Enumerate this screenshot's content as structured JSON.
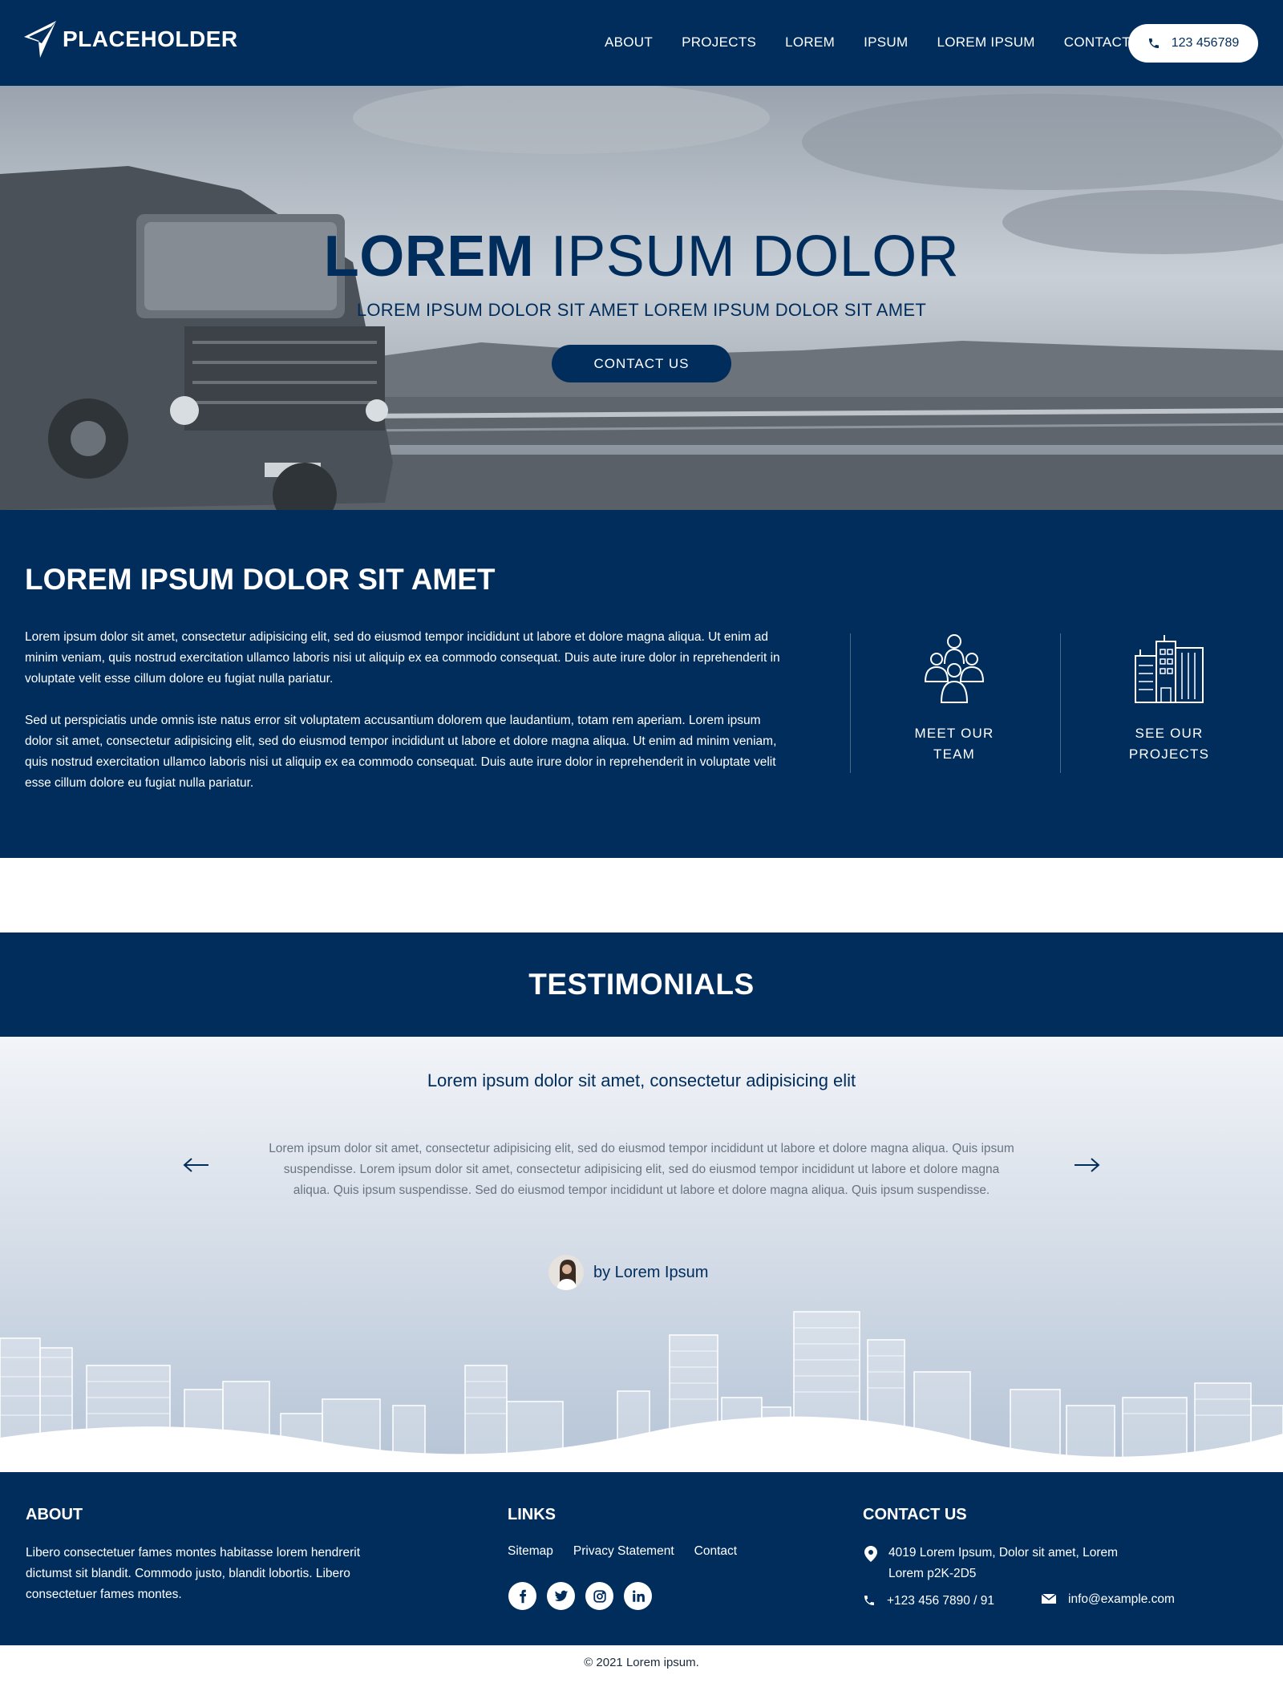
{
  "header": {
    "logo_text": "PLACEHOLDER",
    "nav": [
      "ABOUT",
      "PROJECTS",
      "LOREM",
      "IPSUM",
      "LOREM IPSUM",
      "CONTACT"
    ],
    "phone": "123 456789"
  },
  "hero": {
    "title_bold": "LOREM",
    "title_rest": " IPSUM DOLOR",
    "subtitle": "LOREM IPSUM DOLOR SIT AMET LOREM IPSUM DOLOR SIT AMET",
    "cta": "CONTACT US"
  },
  "intro": {
    "heading_bold": "LOREM",
    "heading_rest": " IPSUM DOLOR SIT AMET",
    "p1": "Lorem ipsum dolor sit amet, consectetur adipisicing elit, sed do eiusmod tempor incididunt ut labore et dolore magna aliqua. Ut enim ad minim veniam, quis nostrud exercitation ullamco laboris nisi ut aliquip ex ea commodo consequat. Duis aute irure dolor in reprehenderit in voluptate velit esse cillum dolore eu fugiat nulla pariatur.",
    "p2": "Sed ut perspiciatis unde omnis iste natus error sit voluptatem accusantium dolorem que laudantium, totam rem aperiam. Lorem ipsum dolor sit amet, consectetur adipisicing elit, sed do eiusmod tempor incididunt ut labore et dolore magna aliqua. Ut enim ad minim veniam, quis nostrud exercitation ullamco laboris nisi ut aliquip ex ea commodo consequat. Duis aute irure dolor in reprehenderit in voluptate velit esse cillum dolore eu fugiat nulla pariatur.",
    "features": [
      {
        "label": "MEET OUR\nTEAM",
        "icon": "team-icon"
      },
      {
        "label": "SEE OUR\nPROJECTS",
        "icon": "buildings-icon"
      }
    ]
  },
  "testimonials": {
    "title": "TESTIMONIALS",
    "quote_title": "Lorem ipsum dolor sit amet, consectetur adipisicing elit",
    "quote_text": "Lorem ipsum dolor sit amet, consectetur adipisicing elit, sed do eiusmod tempor incididunt ut labore et dolore magna aliqua. Quis ipsum suspendisse. Lorem ipsum dolor sit amet, consectetur adipisicing elit, sed do eiusmod tempor incididunt ut labore et dolore magna aliqua. Quis ipsum suspendisse. Sed do eiusmod tempor incididunt ut labore et dolore magna aliqua. Quis ipsum suspendisse.",
    "author": "by Lorem Ipsum"
  },
  "footer": {
    "about_title": "ABOUT",
    "about_text": "Libero consectetuer fames montes habitasse lorem hendrerit dictumst sit blandit. Commodo justo, blandit lobortis. Libero consectetuer fames montes.",
    "links_title": "LINKS",
    "links": [
      "Sitemap",
      "Privacy Statement",
      "Contact"
    ],
    "contact_title": "CONTACT US",
    "address": "4019 Lorem Ipsum, Dolor sit amet, Lorem Lorem p2K-2D5",
    "phone": "+123 456 7890 / 91",
    "email": "info@example.com"
  },
  "copyright": "© 2021 Lorem ipsum.",
  "colors": {
    "navy": "#002d5c",
    "white": "#ffffff",
    "muted": "#6a7480"
  }
}
